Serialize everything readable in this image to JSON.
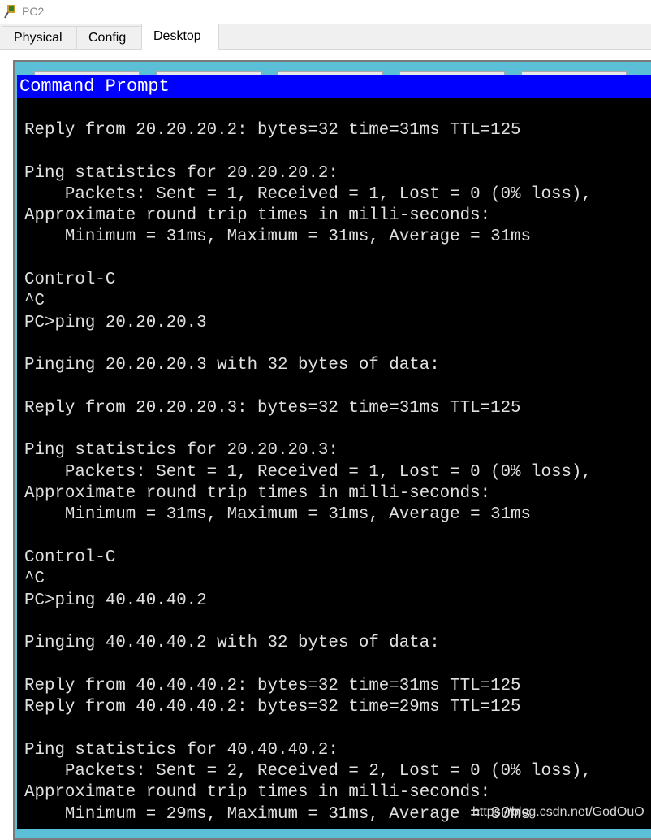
{
  "window": {
    "title": "PC2",
    "icon": "packet-tracer-pc-icon"
  },
  "tabs": [
    {
      "label": "Physical"
    },
    {
      "label": "Config"
    },
    {
      "label": "Desktop",
      "active": true
    }
  ],
  "command_prompt": {
    "title": "Command Prompt",
    "lines": [
      "Reply from 20.20.20.2: bytes=32 time=31ms TTL=125",
      "",
      "Ping statistics for 20.20.20.2:",
      "    Packets: Sent = 1, Received = 1, Lost = 0 (0% loss),",
      "Approximate round trip times in milli-seconds:",
      "    Minimum = 31ms, Maximum = 31ms, Average = 31ms",
      "",
      "Control-C",
      "^C",
      "PC>ping 20.20.20.3",
      "",
      "Pinging 20.20.20.3 with 32 bytes of data:",
      "",
      "Reply from 20.20.20.3: bytes=32 time=31ms TTL=125",
      "",
      "Ping statistics for 20.20.20.3:",
      "    Packets: Sent = 1, Received = 1, Lost = 0 (0% loss),",
      "Approximate round trip times in milli-seconds:",
      "    Minimum = 31ms, Maximum = 31ms, Average = 31ms",
      "",
      "Control-C",
      "^C",
      "PC>ping 40.40.40.2",
      "",
      "Pinging 40.40.40.2 with 32 bytes of data:",
      "",
      "Reply from 40.40.40.2: bytes=32 time=31ms TTL=125",
      "Reply from 40.40.40.2: bytes=32 time=29ms TTL=125",
      "",
      "Ping statistics for 40.40.40.2:",
      "    Packets: Sent = 2, Received = 2, Lost = 0 (0% loss),",
      "Approximate round trip times in milli-seconds:",
      "    Minimum = 29ms, Maximum = 31ms, Average = 30ms"
    ]
  },
  "watermark": "https://blog.csdn.net/GodOuO"
}
